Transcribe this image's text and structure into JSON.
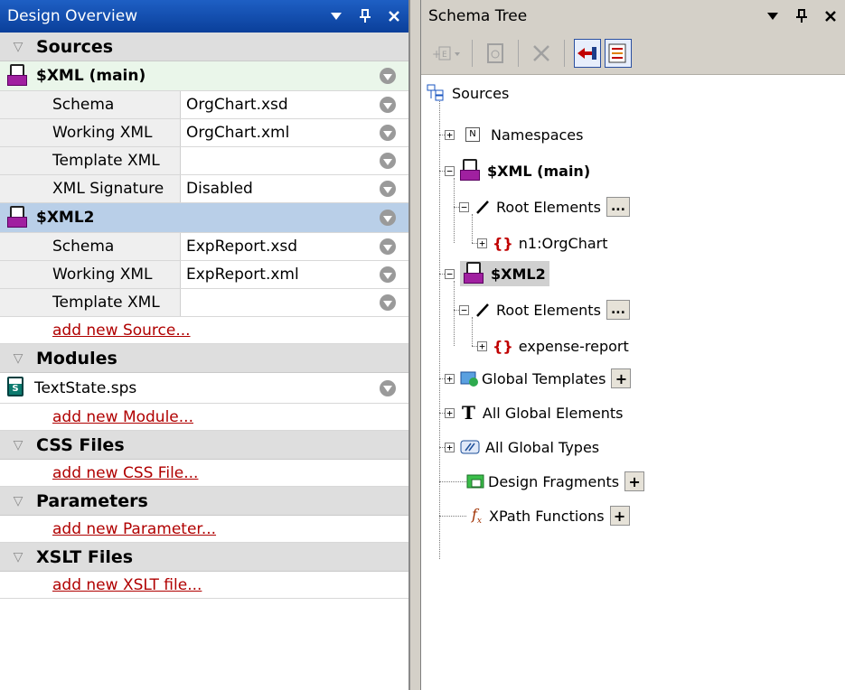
{
  "left_panel": {
    "title": "Design Overview",
    "sections": {
      "sources": {
        "header": "Sources",
        "main": {
          "label": "$XML (main)",
          "props": [
            {
              "key": "Schema",
              "value": "OrgChart.xsd"
            },
            {
              "key": "Working XML",
              "value": "OrgChart.xml"
            },
            {
              "key": "Template XML",
              "value": ""
            },
            {
              "key": "XML Signature",
              "value": "Disabled"
            }
          ]
        },
        "second": {
          "label": "$XML2",
          "props": [
            {
              "key": "Schema",
              "value": "ExpReport.xsd"
            },
            {
              "key": "Working XML",
              "value": "ExpReport.xml"
            },
            {
              "key": "Template XML",
              "value": ""
            }
          ]
        },
        "add_link": "add new Source..."
      },
      "modules": {
        "header": "Modules",
        "item": "TextState.sps",
        "add_link": "add new Module..."
      },
      "css": {
        "header": "CSS Files",
        "add_link": "add new CSS File..."
      },
      "parameters": {
        "header": "Parameters",
        "add_link": "add new Parameter..."
      },
      "xslt": {
        "header": "XSLT Files",
        "add_link": "add new XSLT file..."
      }
    }
  },
  "right_panel": {
    "title": "Schema Tree",
    "tree": {
      "root": "Sources",
      "namespaces": "Namespaces",
      "xml_main": "$XML (main)",
      "root_elements_1": "Root Elements",
      "orgchart": "n1:OrgChart",
      "xml2": "$XML2",
      "root_elements_2": "Root Elements",
      "expense": "expense-report",
      "global_templates": "Global Templates",
      "all_global_elements": "All Global Elements",
      "all_global_types": "All Global Types",
      "design_fragments": "Design Fragments",
      "xpath_functions": "XPath Functions"
    }
  },
  "colors": {
    "title_active": "#0a3f9a",
    "link": "#b00000",
    "selected_row": "#b9cfe8",
    "source_row": "#eaf6ea"
  }
}
